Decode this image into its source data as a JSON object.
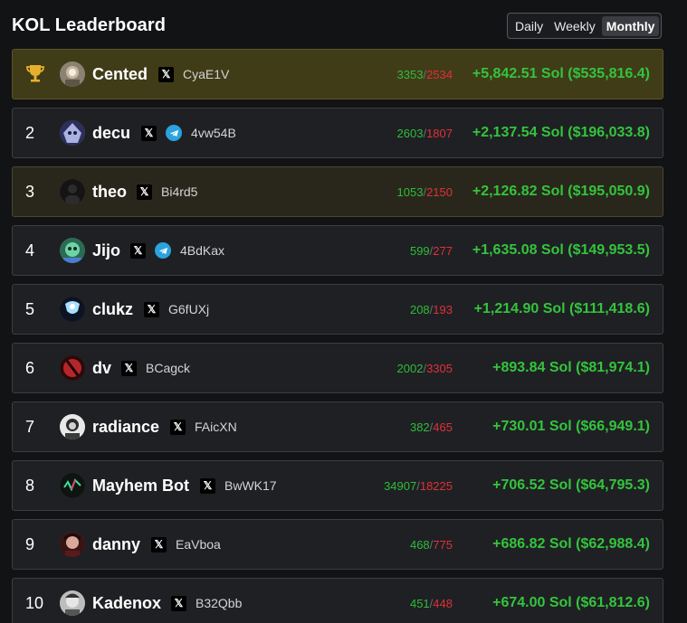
{
  "header": {
    "title": "KOL Leaderboard",
    "periods": [
      "Daily",
      "Weekly",
      "Monthly"
    ],
    "active_period": "Monthly"
  },
  "rows": [
    {
      "rank": "",
      "trophy": true,
      "name": "Cented",
      "x": "𝕏",
      "telegram": false,
      "wallet": "CyaE1V",
      "wins": "3353",
      "losses": "2534",
      "pnl": "+5,842.51 Sol ($535,816.4)"
    },
    {
      "rank": "2",
      "name": "decu",
      "x": "𝕏",
      "telegram": true,
      "wallet": "4vw54B",
      "wins": "2603",
      "losses": "1807",
      "pnl": "+2,137.54 Sol ($196,033.8)"
    },
    {
      "rank": "3",
      "name": "theo",
      "x": "𝕏",
      "telegram": false,
      "wallet": "Bi4rd5",
      "wins": "1053",
      "losses": "2150",
      "pnl": "+2,126.82 Sol ($195,050.9)"
    },
    {
      "rank": "4",
      "name": "Jijo",
      "x": "𝕏",
      "telegram": true,
      "wallet": "4BdKax",
      "wins": "599",
      "losses": "277",
      "pnl": "+1,635.08 Sol ($149,953.5)"
    },
    {
      "rank": "5",
      "name": "clukz",
      "x": "𝕏",
      "telegram": false,
      "wallet": "G6fUXj",
      "wins": "208",
      "losses": "193",
      "pnl": "+1,214.90 Sol ($111,418.6)"
    },
    {
      "rank": "6",
      "name": "dv",
      "x": "𝕏",
      "telegram": false,
      "wallet": "BCagck",
      "wins": "2002",
      "losses": "3305",
      "pnl": "+893.84 Sol ($81,974.1)"
    },
    {
      "rank": "7",
      "name": "radiance",
      "x": "𝕏",
      "telegram": false,
      "wallet": "FAicXN",
      "wins": "382",
      "losses": "465",
      "pnl": "+730.01 Sol ($66,949.1)"
    },
    {
      "rank": "8",
      "name": "Mayhem Bot",
      "x": "𝕏",
      "telegram": false,
      "wallet": "BwWK17",
      "wins": "34907",
      "losses": "18225",
      "pnl": "+706.52 Sol ($64,795.3)"
    },
    {
      "rank": "9",
      "name": "danny",
      "x": "𝕏",
      "telegram": false,
      "wallet": "EaVboa",
      "wins": "468",
      "losses": "775",
      "pnl": "+686.82 Sol ($62,988.4)"
    },
    {
      "rank": "10",
      "name": "Kadenox",
      "x": "𝕏",
      "telegram": false,
      "wallet": "B32Qbb",
      "wins": "451",
      "losses": "448",
      "pnl": "+674.00 Sol ($61,812.6)"
    }
  ],
  "trade_separator": "/"
}
